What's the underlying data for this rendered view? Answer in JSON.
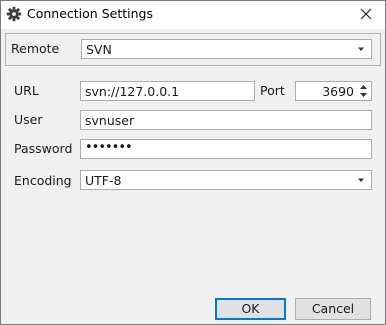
{
  "window": {
    "title": "Connection Settings"
  },
  "remote": {
    "label": "Remote",
    "value": "SVN"
  },
  "url": {
    "label": "URL",
    "value": "svn://127.0.0.1"
  },
  "port": {
    "label": "Port",
    "value": "3690"
  },
  "user": {
    "label": "User",
    "value": "svnuser"
  },
  "password": {
    "label": "Password",
    "value": "•••••••"
  },
  "encoding": {
    "label": "Encoding",
    "value": "UTF-8"
  },
  "buttons": {
    "ok": "OK",
    "cancel": "Cancel"
  },
  "icons": {
    "title": "gear-icon",
    "close": "close-icon",
    "dropdown": "chevron-down-icon",
    "spin_up": "spin-up-arrow-icon",
    "spin_down": "spin-down-arrow-icon"
  },
  "colors": {
    "default_button_border": "#0078d7",
    "window_bg": "#f0f0f0"
  }
}
